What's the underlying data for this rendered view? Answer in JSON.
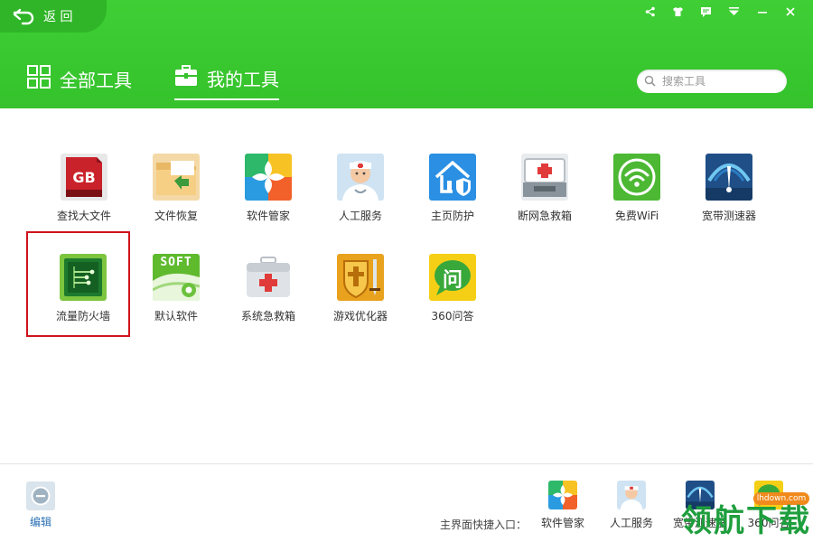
{
  "header": {
    "back_label": "返 回",
    "tabs": [
      {
        "label": "全部工具",
        "icon": "grid-icon",
        "active": false
      },
      {
        "label": "我的工具",
        "icon": "toolbox-icon",
        "active": true
      }
    ],
    "search": {
      "placeholder": "搜索工具"
    },
    "window_controls": [
      "share-icon",
      "skin-icon",
      "message-icon",
      "menu-icon",
      "minimize-icon",
      "close-icon"
    ]
  },
  "tools": [
    {
      "label": "查找大文件",
      "icon": "gb-file-icon"
    },
    {
      "label": "文件恢复",
      "icon": "folder-restore-icon"
    },
    {
      "label": "软件管家",
      "icon": "software-manager-icon"
    },
    {
      "label": "人工服务",
      "icon": "doctor-icon"
    },
    {
      "label": "主页防护",
      "icon": "home-shield-icon"
    },
    {
      "label": "断网急救箱",
      "icon": "network-firstaid-icon"
    },
    {
      "label": "免费WiFi",
      "icon": "wifi-icon"
    },
    {
      "label": "宽带测速器",
      "icon": "speedometer-icon"
    },
    {
      "label": "流量防火墙",
      "icon": "traffic-firewall-icon"
    },
    {
      "label": "默认软件",
      "icon": "default-software-icon",
      "icon_text": "SOFT"
    },
    {
      "label": "系统急救箱",
      "icon": "system-firstaid-icon"
    },
    {
      "label": "游戏优化器",
      "icon": "game-optimizer-icon"
    },
    {
      "label": "360问答",
      "icon": "qa-icon",
      "icon_text": "问"
    }
  ],
  "footer": {
    "edit_label": "编辑",
    "quick_entry_label": "主界面快捷入口：",
    "quick_tools": [
      {
        "label": "软件管家",
        "icon": "software-manager-icon"
      },
      {
        "label": "人工服务",
        "icon": "doctor-icon"
      },
      {
        "label": "宽带测速器",
        "icon": "speedometer-icon"
      },
      {
        "label": "360问答",
        "icon": "qa-icon"
      }
    ]
  },
  "watermark": {
    "text": "领航下载",
    "badge": "lhdown.com"
  },
  "colors": {
    "header_green": "#35c22c",
    "highlight_red": "#d0121b",
    "link_blue": "#2a6fb4"
  }
}
